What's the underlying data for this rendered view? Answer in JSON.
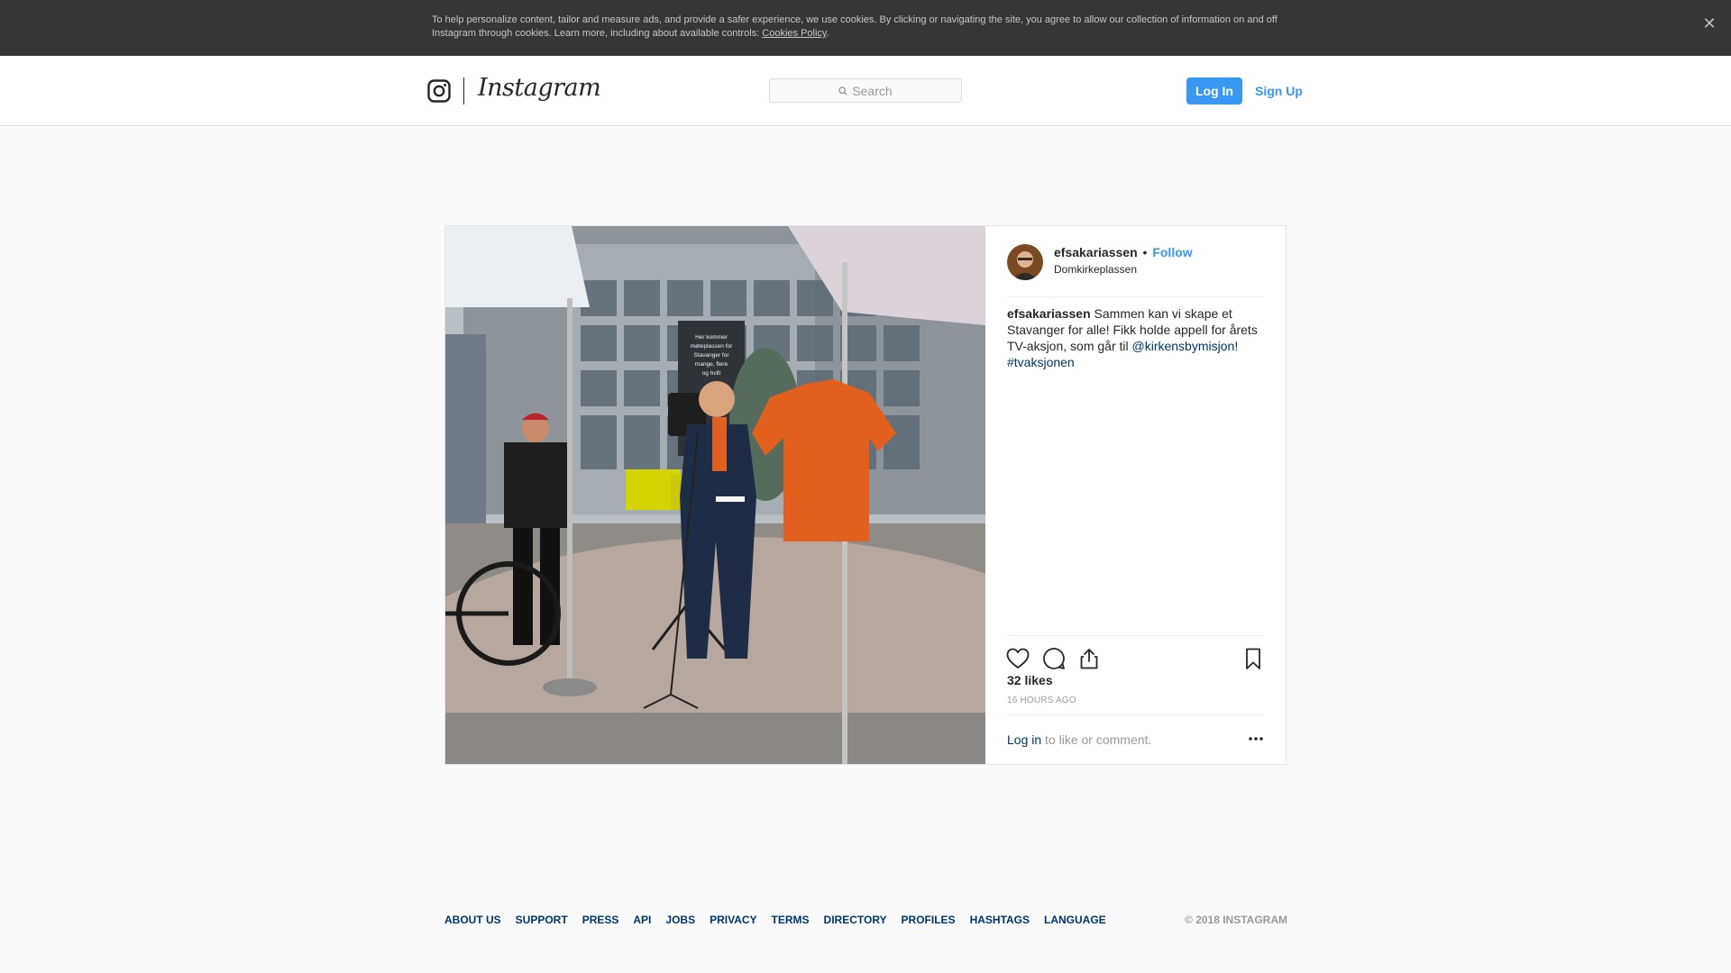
{
  "cookie_banner": {
    "text": "To help personalize content, tailor and measure ads, and provide a safer experience, we use cookies. By clicking or navigating the site, you agree to allow our collection of information on and off Instagram through cookies. Learn more, including about available controls: ",
    "link": "Cookies Policy",
    "period": ".",
    "close_icon": "close-icon"
  },
  "header": {
    "logo_icon": "instagram-glyph-icon",
    "wordmark": "Instagram",
    "search": {
      "placeholder": "Search",
      "value": ""
    },
    "login_label": "Log In",
    "signup_label": "Sign Up",
    "accent": "#3897f0"
  },
  "post": {
    "username": "efsakariassen",
    "separator": "•",
    "follow_label": "Follow",
    "location": "Domkirkeplassen",
    "caption": {
      "user": "efsakariassen",
      "text": " Sammen kan vi skape et Stavanger for alle! Fikk holde appell for årets TV-aksjon, som går til ",
      "mention": "@kirkensbymisjon",
      "after": "! ",
      "hashtag": "#tvaksjonen"
    },
    "photo_sign": [
      "Her kommer",
      "møteplassen for",
      "Stavanger for",
      "mange, flere",
      "og hvilt"
    ],
    "icons": [
      "heart-icon",
      "comment-icon",
      "share-icon",
      "bookmark-icon",
      "more-icon"
    ],
    "likes": "32 likes",
    "timestamp": "16 HOURS AGO",
    "comment_prompt": {
      "login": "Log in",
      "rest": " to like or comment."
    }
  },
  "footer": {
    "links": [
      "ABOUT US",
      "SUPPORT",
      "PRESS",
      "API",
      "JOBS",
      "PRIVACY",
      "TERMS",
      "DIRECTORY",
      "PROFILES",
      "HASHTAGS",
      "LANGUAGE"
    ],
    "copyright": "© 2018 INSTAGRAM"
  }
}
